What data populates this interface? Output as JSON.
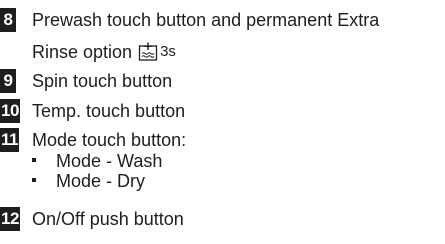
{
  "items": [
    {
      "number": "8",
      "line1": "Prewash touch button and permanent Extra",
      "line2": "Rinse option",
      "symbol_icon": "extra-rinse-icon",
      "symbol_label": "3s"
    },
    {
      "number": "9",
      "text": "Spin touch button"
    },
    {
      "number": "10",
      "text": "Temp. touch button"
    },
    {
      "number": "11",
      "text": "Mode touch button:",
      "bullets": [
        "Mode - Wash",
        "Mode - Dry"
      ]
    },
    {
      "number": "12",
      "text": "On/Off push button"
    }
  ]
}
